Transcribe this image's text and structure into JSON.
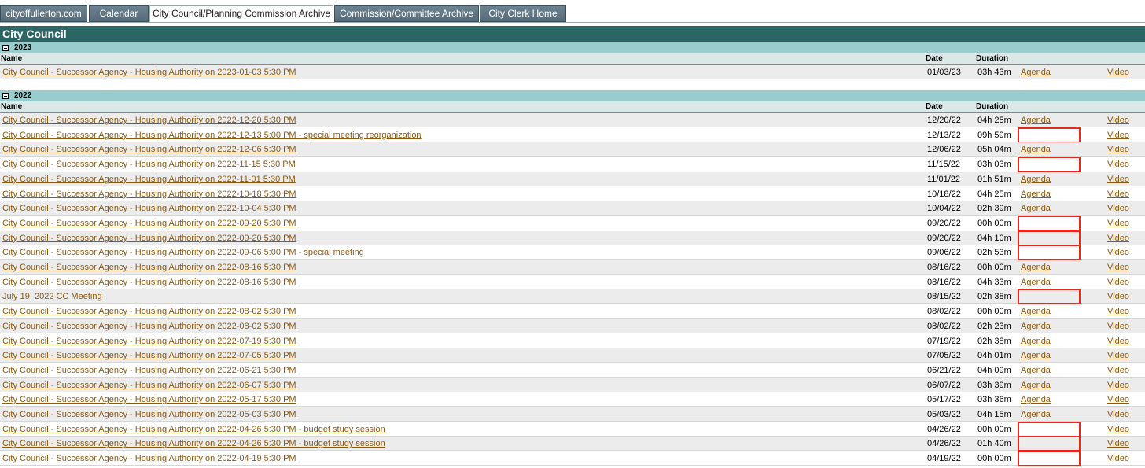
{
  "tabs": [
    "cityoffullerton.com",
    "Calendar",
    "City Council/Planning Commission Archive",
    "Commission/Committee Archive",
    "City Clerk Home"
  ],
  "section_title": "City Council",
  "columns": {
    "name": "Name",
    "date": "Date",
    "duration": "Duration"
  },
  "agenda_label": "Agenda",
  "video_label": "Video",
  "groups": [
    {
      "year": "2023",
      "rows": [
        {
          "name": "City Council - Successor Agency - Housing Authority on 2023-01-03 5:30 PM",
          "date": "01/03/23",
          "duration": "03h 43m",
          "agenda": true
        }
      ]
    },
    {
      "year": "2022",
      "rows": [
        {
          "name": "City Council - Successor Agency - Housing Authority on 2022-12-20 5:30 PM",
          "date": "12/20/22",
          "duration": "04h 25m",
          "agenda": true
        },
        {
          "name": "City Council - Successor Agency - Housing Authority on 2022-12-13 5:00 PM - special meeting reorganization",
          "date": "12/13/22",
          "duration": "09h 59m",
          "agenda": false
        },
        {
          "name": "City Council - Successor Agency - Housing Authority on 2022-12-06 5:30 PM",
          "date": "12/06/22",
          "duration": "05h 04m",
          "agenda": true
        },
        {
          "name": "City Council - Successor Agency - Housing Authority on 2022-11-15 5:30 PM",
          "date": "11/15/22",
          "duration": "03h 03m",
          "agenda": false
        },
        {
          "name": "City Council - Successor Agency - Housing Authority on 2022-11-01 5:30 PM",
          "date": "11/01/22",
          "duration": "01h 51m",
          "agenda": true
        },
        {
          "name": "City Council - Successor Agency - Housing Authority on 2022-10-18 5:30 PM",
          "date": "10/18/22",
          "duration": "04h 25m",
          "agenda": true
        },
        {
          "name": "City Council - Successor Agency - Housing Authority on 2022-10-04 5:30 PM",
          "date": "10/04/22",
          "duration": "02h 39m",
          "agenda": true
        },
        {
          "name": "City Council - Successor Agency - Housing Authority on 2022-09-20 5:30 PM",
          "date": "09/20/22",
          "duration": "00h 00m",
          "agenda": false
        },
        {
          "name": "City Council - Successor Agency - Housing Authority on 2022-09-20 5:30 PM",
          "date": "09/20/22",
          "duration": "04h 10m",
          "agenda": false
        },
        {
          "name": "City Council - Successor Agency - Housing Authority on 2022-09-06 5:00 PM - special meeting",
          "date": "09/06/22",
          "duration": "02h 53m",
          "agenda": false
        },
        {
          "name": "City Council - Successor Agency - Housing Authority on 2022-08-16 5:30 PM",
          "date": "08/16/22",
          "duration": "00h 00m",
          "agenda": true
        },
        {
          "name": "City Council - Successor Agency - Housing Authority on 2022-08-16 5:30 PM",
          "date": "08/16/22",
          "duration": "04h 33m",
          "agenda": true
        },
        {
          "name": "July 19, 2022 CC Meeting",
          "date": "08/15/22",
          "duration": "02h 38m",
          "agenda": false
        },
        {
          "name": "City Council - Successor Agency - Housing Authority on 2022-08-02 5:30 PM",
          "date": "08/02/22",
          "duration": "00h 00m",
          "agenda": true
        },
        {
          "name": "City Council - Successor Agency - Housing Authority on 2022-08-02 5:30 PM",
          "date": "08/02/22",
          "duration": "02h 23m",
          "agenda": true
        },
        {
          "name": "City Council - Successor Agency - Housing Authority on 2022-07-19 5:30 PM",
          "date": "07/19/22",
          "duration": "02h 38m",
          "agenda": true
        },
        {
          "name": "City Council - Successor Agency - Housing Authority on 2022-07-05 5:30 PM",
          "date": "07/05/22",
          "duration": "04h 01m",
          "agenda": true
        },
        {
          "name": "City Council - Successor Agency - Housing Authority on 2022-06-21 5:30 PM",
          "date": "06/21/22",
          "duration": "04h 09m",
          "agenda": true
        },
        {
          "name": "City Council - Successor Agency - Housing Authority on 2022-06-07 5:30 PM",
          "date": "06/07/22",
          "duration": "03h 39m",
          "agenda": true
        },
        {
          "name": "City Council - Successor Agency - Housing Authority on 2022-05-17 5:30 PM",
          "date": "05/17/22",
          "duration": "03h 36m",
          "agenda": true
        },
        {
          "name": "City Council - Successor Agency - Housing Authority on 2022-05-03 5:30 PM",
          "date": "05/03/22",
          "duration": "04h 15m",
          "agenda": true
        },
        {
          "name": "City Council - Successor Agency - Housing Authority on 2022-04-26 5:30 PM - budget study session",
          "date": "04/26/22",
          "duration": "00h 00m",
          "agenda": false
        },
        {
          "name": "City Council - Successor Agency - Housing Authority on 2022-04-26 5:30 PM - budget study session",
          "date": "04/26/22",
          "duration": "01h 40m",
          "agenda": false
        },
        {
          "name": "City Council - Successor Agency - Housing Authority on 2022-04-19 5:30 PM",
          "date": "04/19/22",
          "duration": "00h 00m",
          "agenda": false
        }
      ]
    }
  ]
}
